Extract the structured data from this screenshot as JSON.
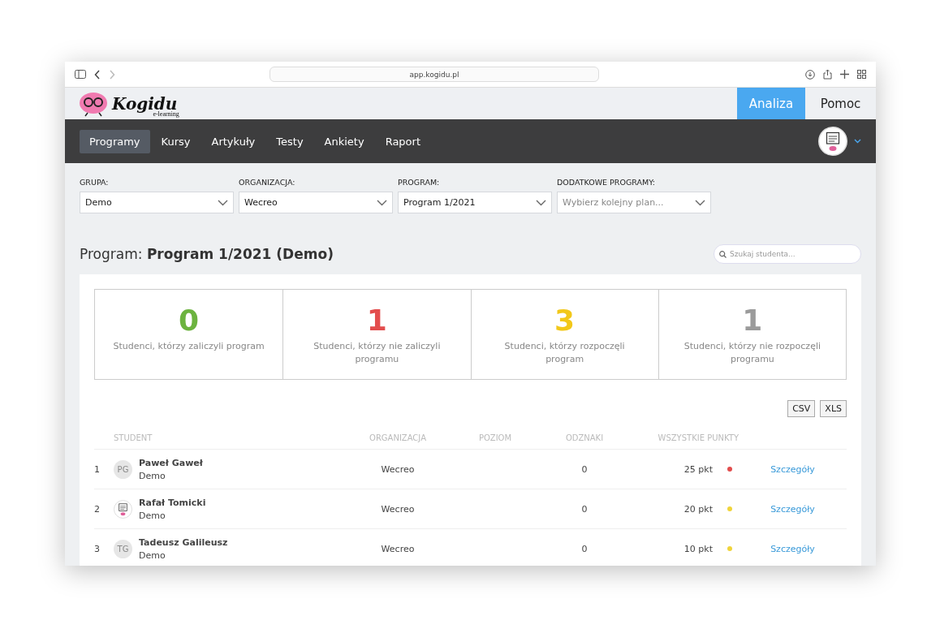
{
  "browser": {
    "url": "app.kogidu.pl"
  },
  "header": {
    "logo_text": "Kogidu",
    "logo_subtitle": "e-learning",
    "buttons": [
      {
        "label": "Analiza",
        "selected": true
      },
      {
        "label": "Pomoc",
        "selected": false
      }
    ]
  },
  "nav": {
    "items": [
      {
        "label": "Programy",
        "selected": true
      },
      {
        "label": "Kursy",
        "selected": false
      },
      {
        "label": "Artykuły",
        "selected": false
      },
      {
        "label": "Testy",
        "selected": false
      },
      {
        "label": "Ankiety",
        "selected": false
      },
      {
        "label": "Raport",
        "selected": false
      }
    ]
  },
  "filters": [
    {
      "label": "GRUPA:",
      "value": "Demo"
    },
    {
      "label": "ORGANIZACJA:",
      "value": "Wecreo"
    },
    {
      "label": "PROGRAM:",
      "value": "Program 1/2021"
    },
    {
      "label": "DODATKOWE PROGRAMY:",
      "placeholder": "Wybierz kolejny plan..."
    }
  ],
  "heading": {
    "prefix": "Program:",
    "title": "Program 1/2021 (Demo)"
  },
  "search": {
    "placeholder": "Szukaj studenta..."
  },
  "stats": [
    {
      "value": "0",
      "label": "Studenci, którzy zaliczyli program",
      "color": "#6cb33f"
    },
    {
      "value": "1",
      "label": "Studenci, którzy nie zaliczyli programu",
      "color": "#e34d4d"
    },
    {
      "value": "3",
      "label": "Studenci, którzy rozpoczęli program",
      "color": "#f2c81a"
    },
    {
      "value": "1",
      "label": "Studenci, którzy nie rozpoczęli programu",
      "color": "#9b9b9b"
    }
  ],
  "exports": [
    "CSV",
    "XLS"
  ],
  "table": {
    "columns": [
      "STUDENT",
      "ORGANIZACJA",
      "POZIOM",
      "ODZNAKI",
      "WSZYSTKIE PUNKTY"
    ],
    "rows": [
      {
        "index": "1",
        "avatar": {
          "kind": "initials",
          "text": "PG"
        },
        "name": "Paweł Gaweł",
        "group": "Demo",
        "organization": "Wecreo",
        "badges": "0",
        "points": "25 pkt",
        "color": "#e24c4c",
        "action": "Szczegóły"
      },
      {
        "index": "2",
        "name": "Rafał Tomicki",
        "group": "Demo",
        "organization": "Wecreo",
        "badges": "0",
        "points": "20 pkt",
        "color": "#f0d43a",
        "action": "Szczegóły"
      },
      {
        "index": "3",
        "avatar": {
          "kind": "initials",
          "text": "TG"
        },
        "name": "Tadeusz Galileusz",
        "group": "Demo",
        "organization": "Wecreo",
        "badges": "0",
        "points": "10 pkt",
        "color": "#f0d43a",
        "action": "Szczegóły"
      }
    ]
  }
}
